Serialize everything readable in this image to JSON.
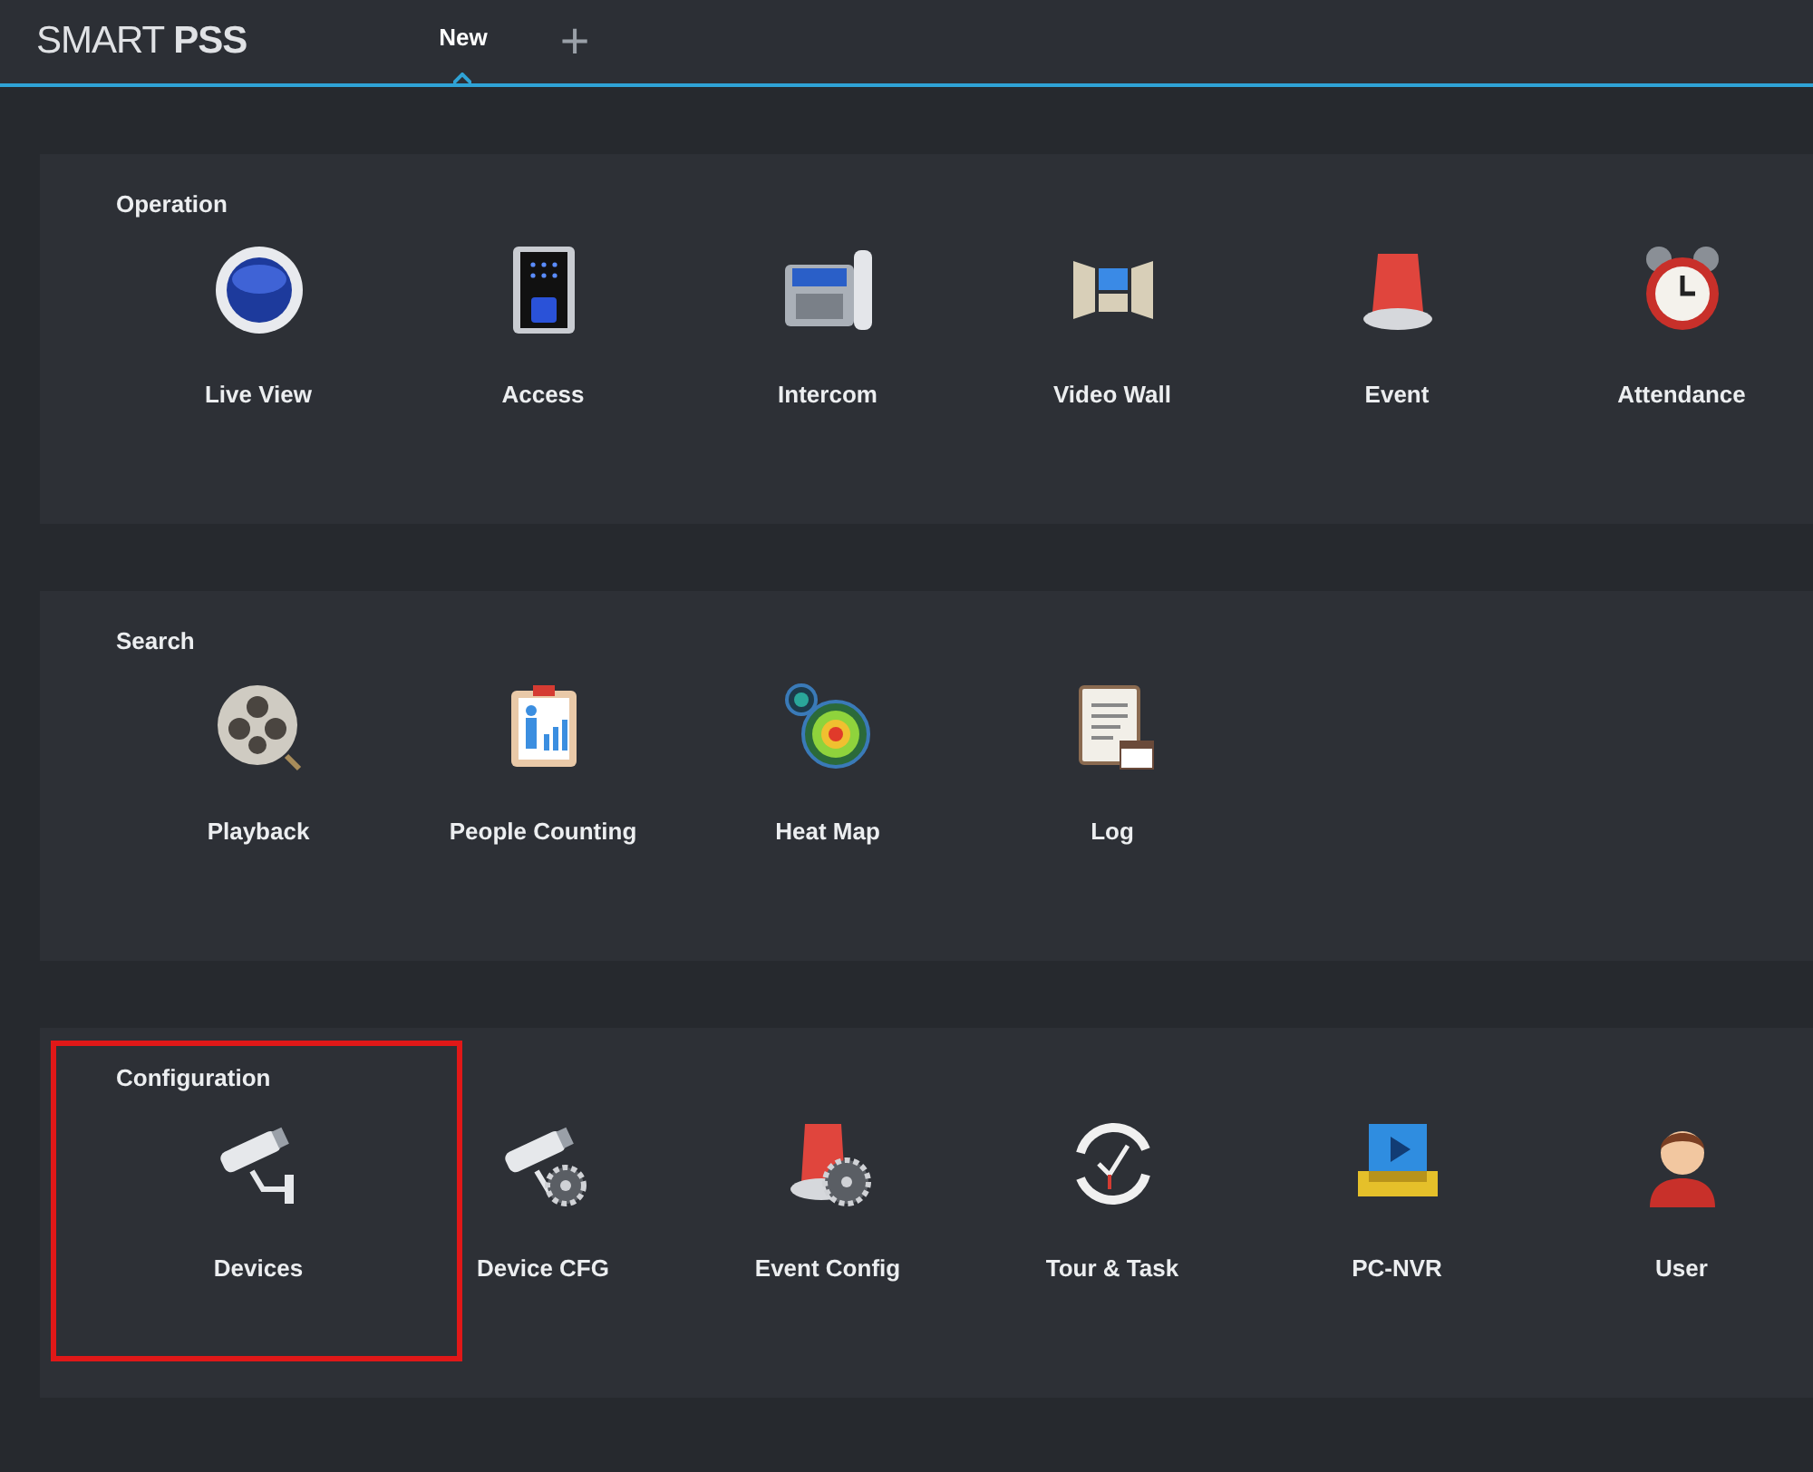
{
  "app": {
    "title": "SMART ",
    "title_bold": "PSS"
  },
  "tabs": [
    {
      "label": "New",
      "selected": true
    }
  ],
  "add_tab": {
    "label": "+"
  },
  "sections": [
    {
      "title": "Operation",
      "items": [
        {
          "label": "Live View",
          "highlighted": false
        },
        {
          "label": "Access",
          "highlighted": false
        },
        {
          "label": "Intercom",
          "highlighted": false
        },
        {
          "label": "Video Wall",
          "highlighted": false
        },
        {
          "label": "Event",
          "highlighted": false
        },
        {
          "label": "Attendance",
          "highlighted": false
        }
      ]
    },
    {
      "title": "Search",
      "items": [
        {
          "label": "Playback",
          "highlighted": false
        },
        {
          "label": "People Counting",
          "highlighted": false
        },
        {
          "label": "Heat Map",
          "highlighted": false
        },
        {
          "label": "Log",
          "highlighted": false
        }
      ]
    },
    {
      "title": "Configuration",
      "items": [
        {
          "label": "Devices",
          "highlighted": true
        },
        {
          "label": "Device CFG",
          "highlighted": false
        },
        {
          "label": "Event Config",
          "highlighted": false
        },
        {
          "label": "Tour & Task",
          "highlighted": false
        },
        {
          "label": "PC-NVR",
          "highlighted": false
        },
        {
          "label": "User",
          "highlighted": false
        }
      ]
    }
  ]
}
